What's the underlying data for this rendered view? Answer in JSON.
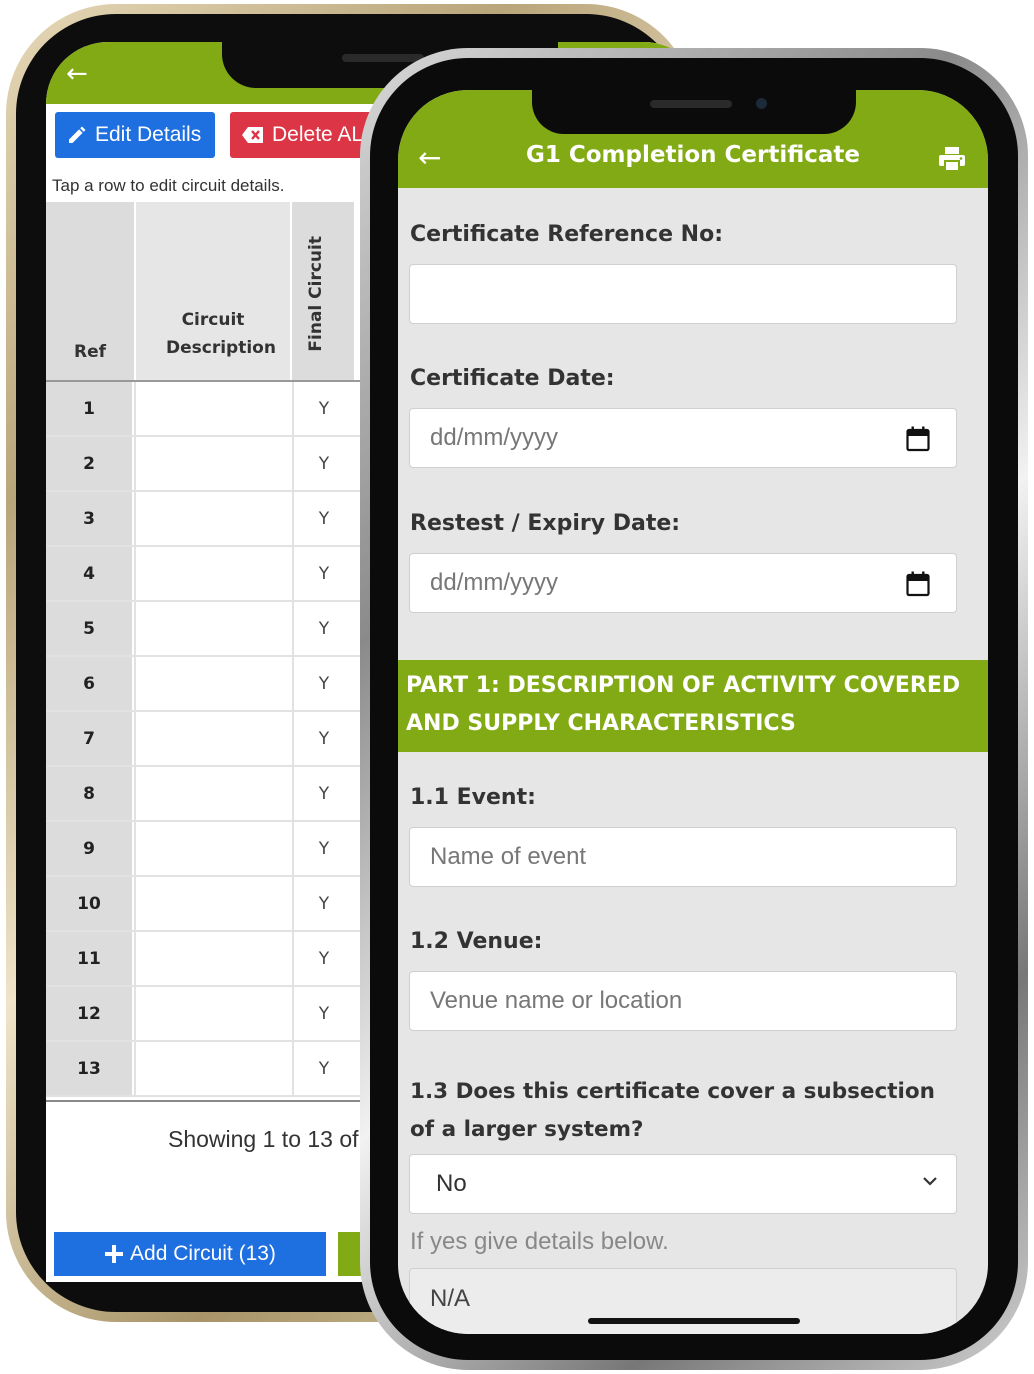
{
  "back_phone": {
    "edit_details": "Edit Details",
    "delete_all": "Delete ALL",
    "hint": "Tap a row to edit circuit details.",
    "table": {
      "col_ref": "Ref",
      "col_desc": "Circuit Description",
      "col_final": "Final Circuit",
      "rows": [
        {
          "ref": "1",
          "final": "Y"
        },
        {
          "ref": "2",
          "final": "Y"
        },
        {
          "ref": "3",
          "final": "Y"
        },
        {
          "ref": "4",
          "final": "Y"
        },
        {
          "ref": "5",
          "final": "Y"
        },
        {
          "ref": "6",
          "final": "Y"
        },
        {
          "ref": "7",
          "final": "Y"
        },
        {
          "ref": "8",
          "final": "Y"
        },
        {
          "ref": "9",
          "final": "Y"
        },
        {
          "ref": "10",
          "final": "Y"
        },
        {
          "ref": "11",
          "final": "Y"
        },
        {
          "ref": "12",
          "final": "Y"
        },
        {
          "ref": "13",
          "final": "Y"
        }
      ]
    },
    "showing": "Showing 1 to 13 of",
    "add_circuit": "Add Circuit (13)"
  },
  "front_phone": {
    "title": "G1 Completion Certificate",
    "ref_label": "Certificate Reference No:",
    "ref_value": "",
    "date_label": "Certificate Date:",
    "date_placeholder": "dd/mm/yyyy",
    "expiry_label": "Restest / Expiry Date:",
    "expiry_placeholder": "dd/mm/yyyy",
    "section_title": "PART 1: DESCRIPTION OF ACTIVITY COVERED AND SUPPLY CHARACTERISTICS",
    "event_label": "1.1 Event:",
    "event_placeholder": "Name of event",
    "venue_label": "1.2 Venue:",
    "venue_placeholder": "Venue name or location",
    "subsection_label": "1.3 Does this certificate cover a subsection of a larger system?",
    "subsection_value": "No",
    "subsection_hint": "If yes give details below.",
    "details_value": "N/A"
  },
  "colors": {
    "brand_green": "#82aa14",
    "primary_blue": "#1e6fe0",
    "danger_red": "#dc3545"
  }
}
